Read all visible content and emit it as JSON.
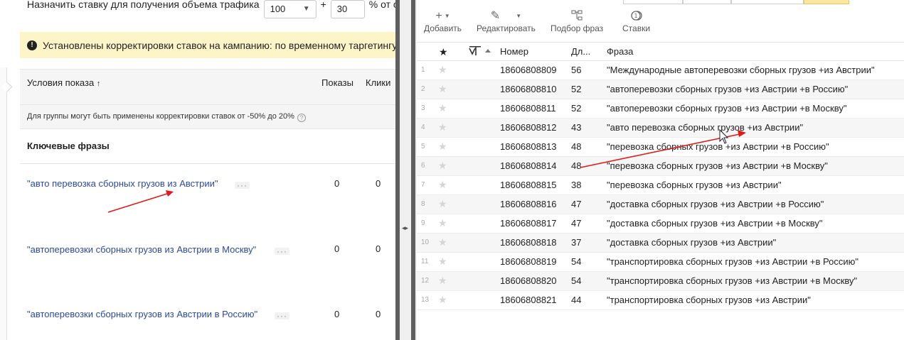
{
  "left": {
    "traffic": {
      "label": "Назначить ставку для получения объема трафика",
      "select_value": "100",
      "plus": "+",
      "input_value": "30",
      "suffix": "% от ставки"
    },
    "notice": "Установлены корректировки ставок на кампанию: по временному таргетингу, по п",
    "columns": {
      "conditions": "Условия показа",
      "sort_arrow": "↑",
      "shows": "Показы",
      "clicks": "Клики"
    },
    "sub_note": "Для группы могут быть применены корректировки ставок от -50% до 20%",
    "keywords_title": "Ключевые фразы",
    "keywords": [
      {
        "text": "\"авто перевозка сборных грузов из Австрии\"",
        "shows": "0",
        "clicks": "0"
      },
      {
        "text": "\"автоперевозки сборных грузов из Австрии в Москву\"",
        "shows": "0",
        "clicks": "0"
      },
      {
        "text": "\"автоперевозки сборных грузов из Австрии в Россию\"",
        "shows": "0",
        "clicks": "0"
      }
    ],
    "dots": "···"
  },
  "right": {
    "toolbar": {
      "add": "Добавить",
      "edit": "Редактировать",
      "pick": "Подбор фраз",
      "bids": "Ставки"
    },
    "columns": {
      "star": "★",
      "number": "Номер",
      "length": "Дл...",
      "phrase": "Фраза"
    },
    "rows": [
      {
        "n": "1",
        "id": "18606808809",
        "len": "56",
        "phrase": "\"Международные автоперевозки сборных грузов +из Австрии\""
      },
      {
        "n": "2",
        "id": "18606808810",
        "len": "52",
        "phrase": "\"автоперевозки сборных грузов +из Австрии +в Россию\""
      },
      {
        "n": "3",
        "id": "18606808811",
        "len": "52",
        "phrase": "\"автоперевозки сборных грузов +из Австрии +в Москву\""
      },
      {
        "n": "4",
        "id": "18606808812",
        "len": "43",
        "phrase": "\"авто перевозка сборных грузов +из Австрии\""
      },
      {
        "n": "5",
        "id": "18606808813",
        "len": "48",
        "phrase": "\"перевозка сборных грузов +из Австрии +в Россию\""
      },
      {
        "n": "6",
        "id": "18606808814",
        "len": "48",
        "phrase": "\"перевозка сборных грузов +из Австрии +в Москву\""
      },
      {
        "n": "7",
        "id": "18606808815",
        "len": "38",
        "phrase": "\"перевозка сборных грузов +из Австрии\""
      },
      {
        "n": "8",
        "id": "18606808816",
        "len": "47",
        "phrase": "\"доставка сборных грузов +из Австрии +в Россию\""
      },
      {
        "n": "9",
        "id": "18606808817",
        "len": "47",
        "phrase": "\"доставка сборных грузов +из Австрии +в Москву\""
      },
      {
        "n": "10",
        "id": "18606808818",
        "len": "37",
        "phrase": "\"доставка сборных грузов +из Австрии\""
      },
      {
        "n": "11",
        "id": "18606808819",
        "len": "54",
        "phrase": "\"транспортировка сборных грузов +из Австрии +в Россию\""
      },
      {
        "n": "12",
        "id": "18606808820",
        "len": "54",
        "phrase": "\"транспортировка сборных грузов +из Австрии +в Москву\""
      },
      {
        "n": "13",
        "id": "18606808821",
        "len": "44",
        "phrase": "\"транспортировка сборных грузов +из Австрии\""
      }
    ]
  },
  "colors": {
    "link": "#2c4a9c",
    "notice_bg": "#fdf4c8",
    "arrow": "#e01b1b",
    "splitter": "#5f5f5f"
  }
}
